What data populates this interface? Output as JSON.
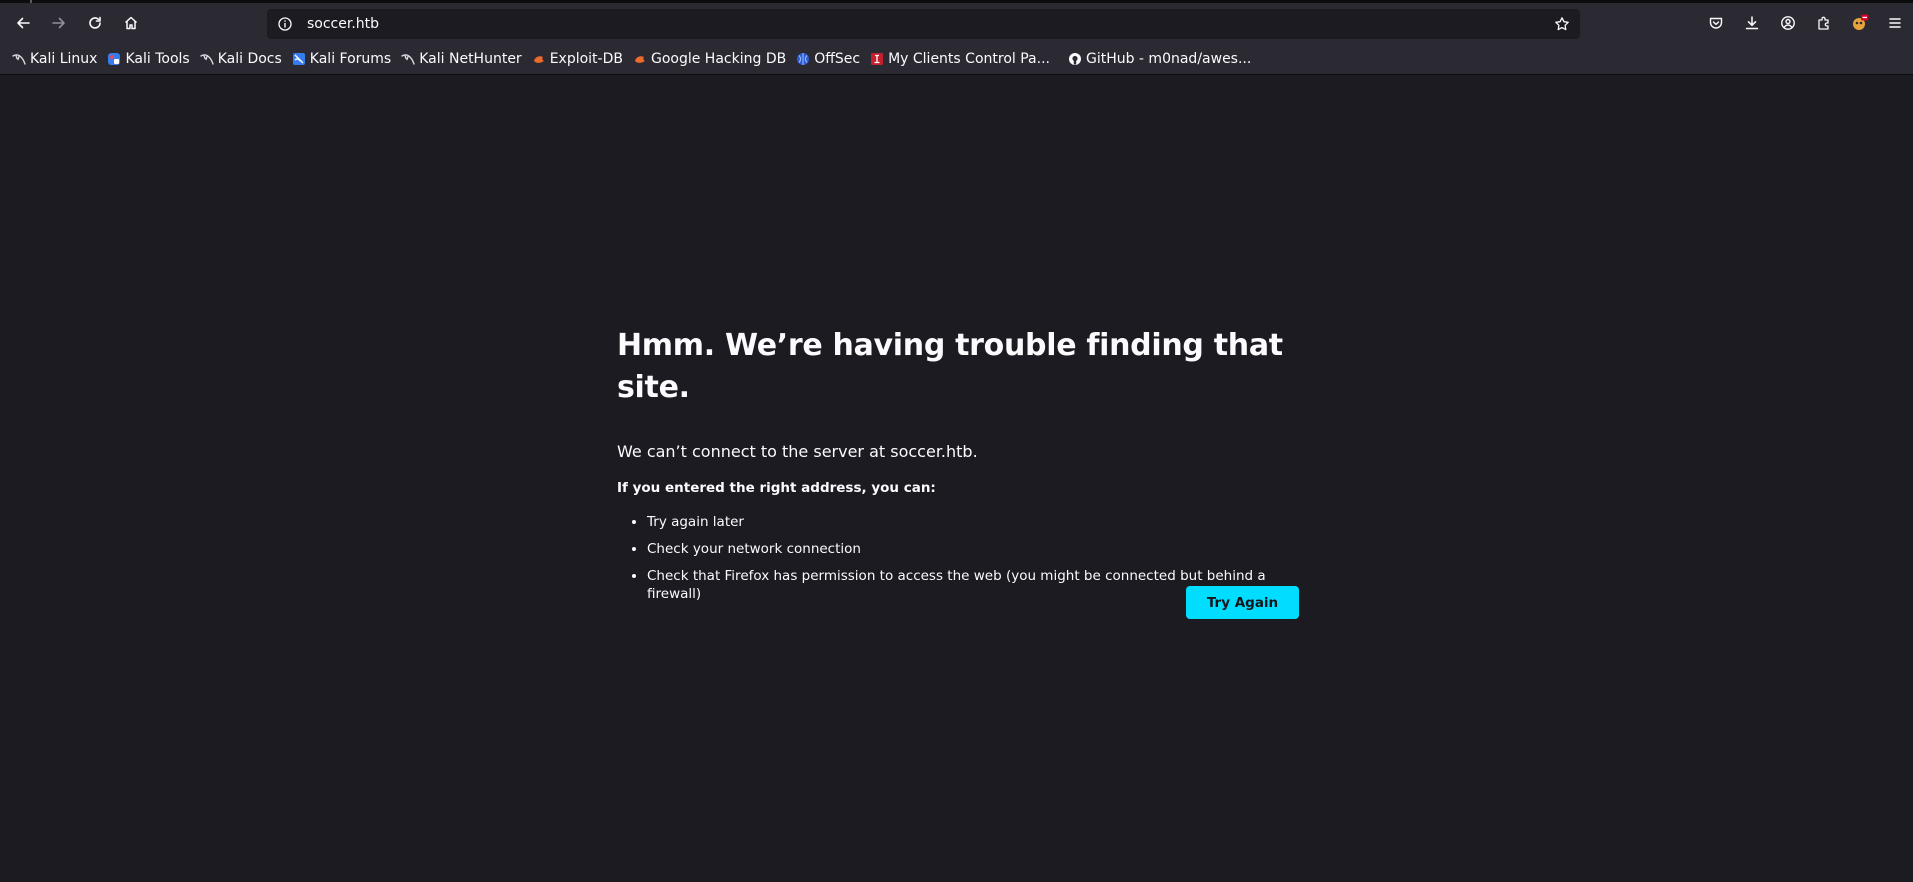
{
  "browser": {
    "url": "soccer.htb"
  },
  "bookmarks": [
    {
      "label": "Kali Linux",
      "icon": "kali-dragon-icon"
    },
    {
      "label": "Kali Tools",
      "icon": "kali-tools-icon"
    },
    {
      "label": "Kali Docs",
      "icon": "kali-dragon-icon"
    },
    {
      "label": "Kali Forums",
      "icon": "kali-forums-icon"
    },
    {
      "label": "Kali NetHunter",
      "icon": "kali-dragon-icon"
    },
    {
      "label": "Exploit-DB",
      "icon": "exploit-db-icon"
    },
    {
      "label": "Google Hacking DB",
      "icon": "exploit-db-icon"
    },
    {
      "label": "OffSec",
      "icon": "offsec-icon"
    },
    {
      "label": "My Clients Control Pa...",
      "icon": "control-panel-icon"
    },
    {
      "label": "GitHub - m0nad/awes...",
      "icon": "github-icon"
    }
  ],
  "error": {
    "title": "Hmm. We’re having trouble finding that site.",
    "description": "We can’t connect to the server at soccer.htb.",
    "subheading": "If you entered the right address, you can:",
    "suggestions": [
      "Try again later",
      "Check your network connection",
      "Check that Firefox has permission to access the web (you might be connected but behind a firewall)"
    ],
    "button_label": "Try Again"
  },
  "colors": {
    "page_background": "#1c1b22",
    "toolbar_background": "#2b2a33",
    "accent_button": "#00ddff",
    "text": "#fbfbfe"
  }
}
